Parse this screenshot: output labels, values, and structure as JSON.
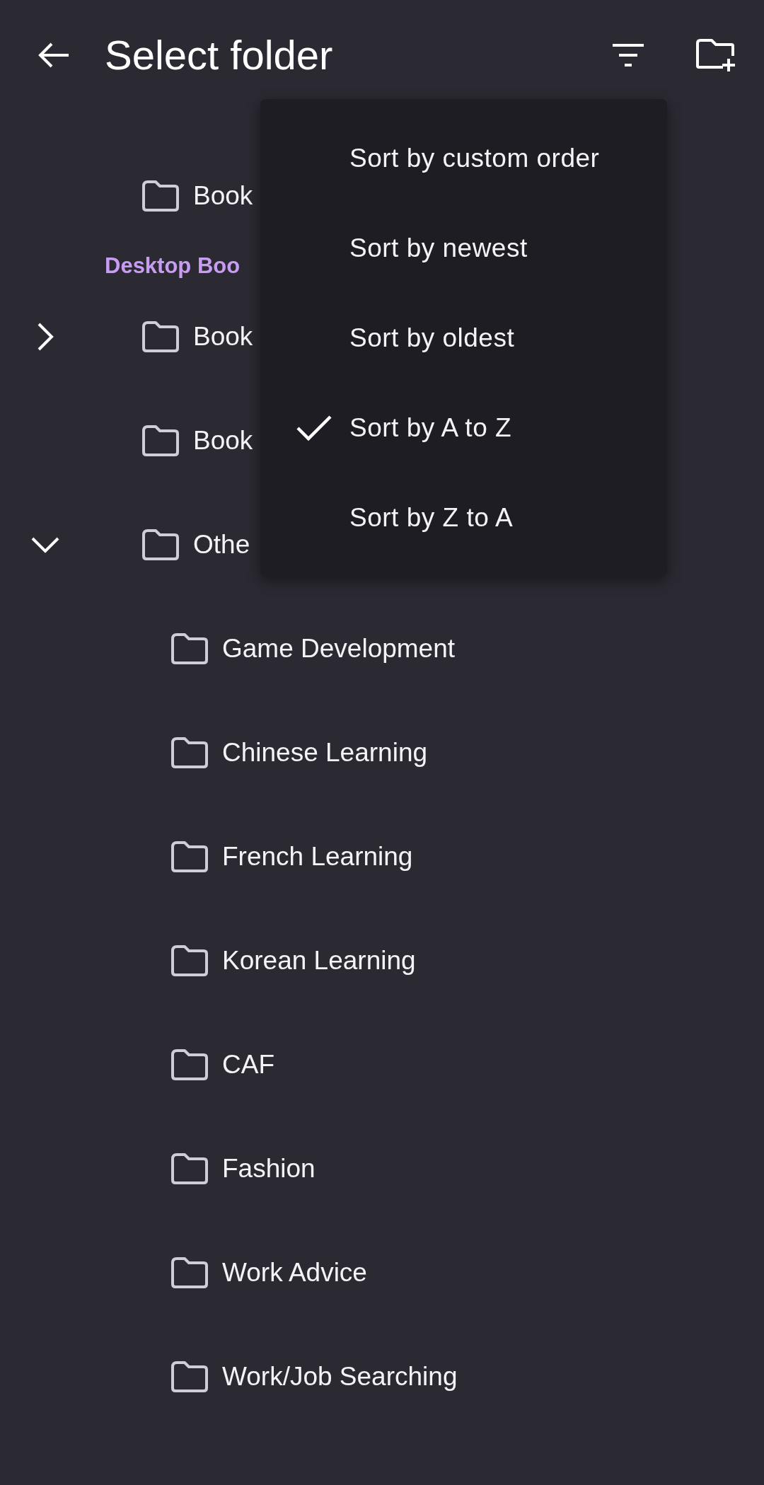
{
  "app_bar": {
    "title": "Select folder"
  },
  "tree": [
    {
      "items": [
        {
          "label": "Book",
          "kind": "folder"
        }
      ]
    },
    {
      "heading": "Desktop Boo",
      "items": [
        {
          "label": "Book",
          "kind": "group",
          "expanded": false
        },
        {
          "label": "Book",
          "kind": "folder"
        },
        {
          "label": "Othe",
          "kind": "group",
          "expanded": true,
          "children": [
            {
              "label": "Game Development",
              "kind": "folder"
            },
            {
              "label": "Chinese Learning",
              "kind": "folder"
            },
            {
              "label": "French Learning",
              "kind": "folder"
            },
            {
              "label": "Korean Learning",
              "kind": "folder"
            },
            {
              "label": "CAF",
              "kind": "folder"
            },
            {
              "label": "Fashion",
              "kind": "folder"
            },
            {
              "label": "Work Advice",
              "kind": "folder"
            },
            {
              "label": "Work/Job Searching",
              "kind": "folder"
            }
          ]
        }
      ]
    }
  ],
  "sort_menu": [
    {
      "label": "Sort by custom order",
      "selected": false
    },
    {
      "label": "Sort by newest",
      "selected": false
    },
    {
      "label": "Sort by oldest",
      "selected": false
    },
    {
      "label": "Sort by A to Z",
      "selected": true
    },
    {
      "label": "Sort by Z to A",
      "selected": false
    }
  ]
}
